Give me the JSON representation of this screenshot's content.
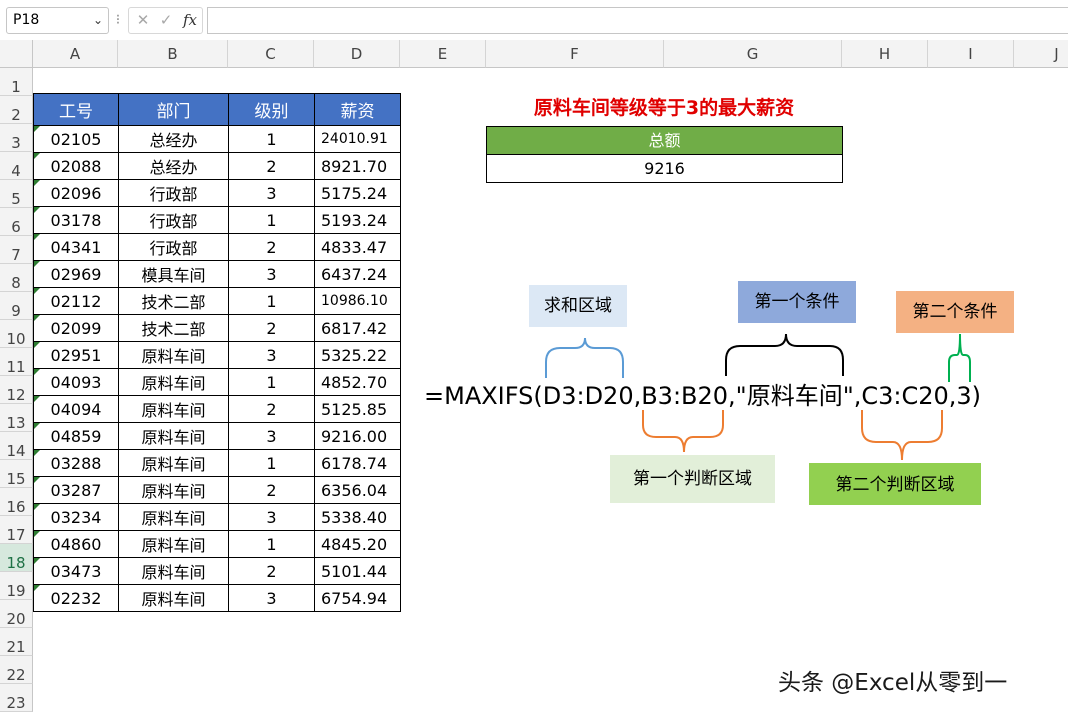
{
  "formula_bar": {
    "name_box": "P18",
    "cancel_icon": "✕",
    "enter_icon": "✓",
    "fx_label": "fx",
    "formula": ""
  },
  "columns": [
    "A",
    "B",
    "C",
    "D",
    "E",
    "F",
    "G",
    "H",
    "I",
    "J"
  ],
  "rows": [
    "1",
    "2",
    "3",
    "4",
    "5",
    "6",
    "7",
    "8",
    "9",
    "10",
    "11",
    "12",
    "13",
    "14",
    "15",
    "16",
    "17",
    "18",
    "19",
    "20",
    "21",
    "22",
    "23"
  ],
  "selected_row": "18",
  "table": {
    "headers": [
      "工号",
      "部门",
      "级别",
      "薪资"
    ],
    "rows": [
      [
        "02105",
        "总经办",
        "1",
        "24010.91"
      ],
      [
        "02088",
        "总经办",
        "2",
        "8921.70"
      ],
      [
        "02096",
        "行政部",
        "3",
        "5175.24"
      ],
      [
        "03178",
        "行政部",
        "1",
        "5193.24"
      ],
      [
        "04341",
        "行政部",
        "2",
        "4833.47"
      ],
      [
        "02969",
        "模具车间",
        "3",
        "6437.24"
      ],
      [
        "02112",
        "技术二部",
        "1",
        "10986.10"
      ],
      [
        "02099",
        "技术二部",
        "2",
        "6817.42"
      ],
      [
        "02951",
        "原料车间",
        "3",
        "5325.22"
      ],
      [
        "04093",
        "原料车间",
        "1",
        "4852.70"
      ],
      [
        "04094",
        "原料车间",
        "2",
        "5125.85"
      ],
      [
        "04859",
        "原料车间",
        "3",
        "9216.00"
      ],
      [
        "03288",
        "原料车间",
        "1",
        "6178.74"
      ],
      [
        "03287",
        "原料车间",
        "2",
        "6356.04"
      ],
      [
        "03234",
        "原料车间",
        "3",
        "5338.40"
      ],
      [
        "04860",
        "原料车间",
        "1",
        "4845.20"
      ],
      [
        "03473",
        "原料车间",
        "2",
        "5101.44"
      ],
      [
        "02232",
        "原料车间",
        "3",
        "6754.94"
      ]
    ]
  },
  "result": {
    "title": "原料车间等级等于3的最大薪资",
    "header": "总额",
    "value": "9216"
  },
  "annotation": {
    "formula": "=MAXIFS(D3:D20,B3:B20,\"原料车间\",C3:C20,3)",
    "sum_range": "求和区域",
    "condition1": "第一个条件",
    "condition2": "第二个条件",
    "criteria_range1": "第一个判断区域",
    "criteria_range2": "第二个判断区域"
  },
  "watermark": "头条 @Excel从零到一",
  "colors": {
    "table_header": "#4472c4",
    "result_header": "#70ad47",
    "title": "#e00000"
  }
}
